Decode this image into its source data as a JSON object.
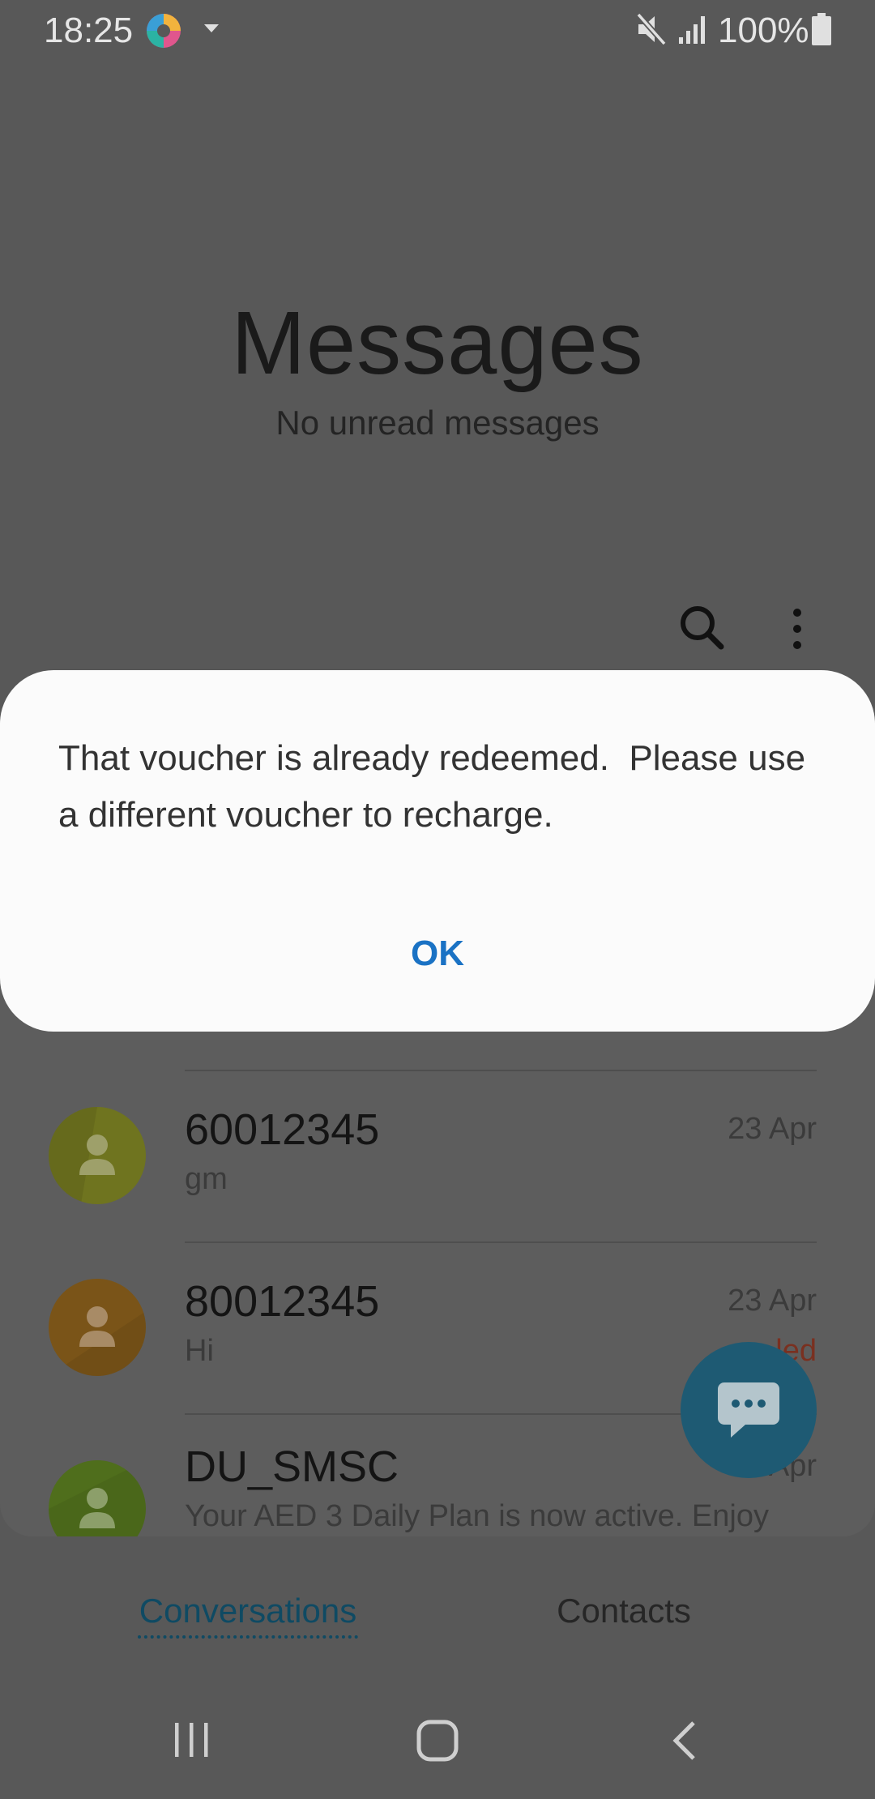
{
  "status_bar": {
    "time": "18:25",
    "battery": "100%"
  },
  "header": {
    "title": "Messages",
    "subtitle": "No unread messages"
  },
  "conversations": [
    {
      "name": "60012345",
      "preview": "gm",
      "date": "23 Apr",
      "avatar_color": "#6f741f"
    },
    {
      "name": "80012345",
      "preview": "Hi",
      "date": "23 Apr",
      "status": "led",
      "avatar_color": "#7a5418"
    },
    {
      "name": "DU_SMSC",
      "preview": "Your AED 3 Daily Plan is now active. Enjoy",
      "date": "4 Apr",
      "avatar_color": "#4f6e1c"
    }
  ],
  "tabs": {
    "conversations": "Conversations",
    "contacts": "Contacts"
  },
  "dialog": {
    "message": "That voucher is already redeemed.  Please use a different voucher to recharge.",
    "ok": "OK"
  },
  "colors": {
    "scrim": "#585858",
    "dialog_bg": "#fbfbfb",
    "accent": "#1a72c4",
    "fab": "#1e5a73"
  }
}
